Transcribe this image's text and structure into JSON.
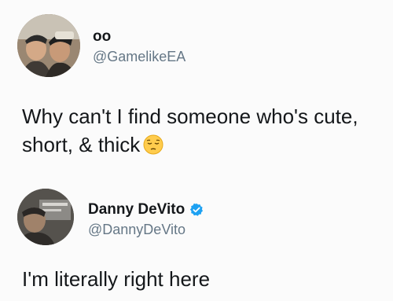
{
  "tweets": [
    {
      "display_name": "oo",
      "handle": "@GamelikeEA",
      "text": "Why can't I find someone who's cute, short, & thick",
      "avatar_icon": "avatar-photo-two-men-icon",
      "emoji_icon": "pensive-face-icon"
    },
    {
      "display_name": "Danny DeVito",
      "handle": "@DannyDeVito",
      "text": "I'm literally right here",
      "avatar_icon": "avatar-photo-dark-icon",
      "verified_icon": "verified-badge-icon",
      "verified_color": "#1da1f2"
    }
  ]
}
